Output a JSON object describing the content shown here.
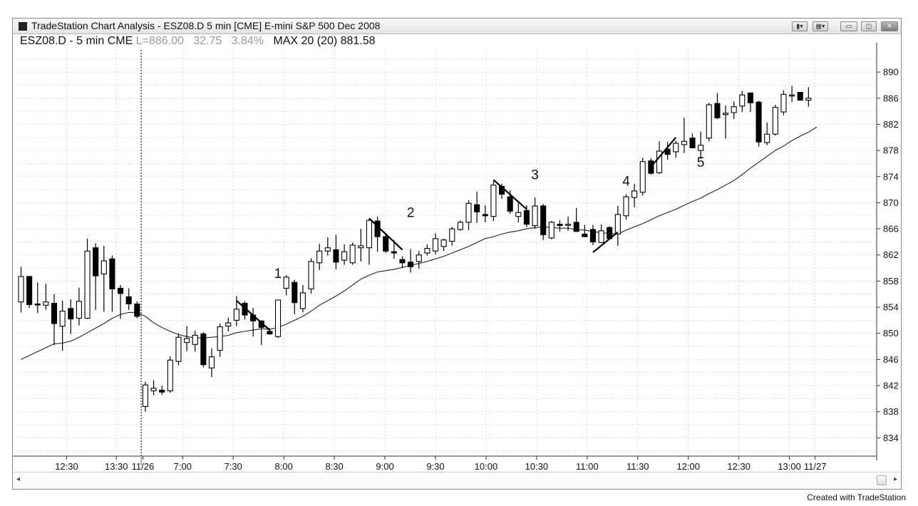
{
  "window": {
    "title": "TradeStation Chart Analysis - ESZ08.D 5 min [CME] E-mini S&P 500 Dec 2008",
    "buttons": [
      "bar-chart-icon",
      "grid-icon",
      "minimize-icon",
      "restore-icon",
      "close-icon"
    ]
  },
  "header": {
    "symbol": "ESZ08.D - 5 min CME",
    "last": "L=886.00",
    "change": "32.75",
    "pct": "3.84%",
    "study": "MAX 20 (20) 881.58"
  },
  "credit": "Created with TradeStation",
  "colors": {
    "candle": "#000000",
    "grid": "#9a9a9a",
    "ma": "#222222"
  },
  "chart_data": {
    "type": "candlestick",
    "y_ticks": [
      890,
      886,
      882,
      878,
      874,
      870,
      866,
      862,
      858,
      854,
      850,
      846,
      842,
      838,
      834
    ],
    "ylim": [
      831.2,
      893.4
    ],
    "x_labels": [
      "12:30",
      "13:30",
      "11/26",
      "7:00",
      "7:30",
      "8:00",
      "8:30",
      "9:00",
      "9:30",
      "10:00",
      "10:30",
      "11:00",
      "11:30",
      "12:00",
      "12:30",
      "13:00",
      "11/27"
    ],
    "session_divider_after_bar": 14,
    "bars": [
      {
        "o": 854.8,
        "h": 860.2,
        "l": 853.2,
        "c": 858.7
      },
      {
        "o": 858.7,
        "h": 858.8,
        "l": 853.9,
        "c": 854.4
      },
      {
        "o": 854.5,
        "h": 857.8,
        "l": 853.1,
        "c": 854.4
      },
      {
        "o": 854.3,
        "h": 857.6,
        "l": 853.6,
        "c": 854.8
      },
      {
        "o": 854.6,
        "h": 856.0,
        "l": 848.2,
        "c": 851.5
      },
      {
        "o": 851.1,
        "h": 855.0,
        "l": 847.3,
        "c": 853.4
      },
      {
        "o": 853.8,
        "h": 855.2,
        "l": 849.9,
        "c": 852.2
      },
      {
        "o": 852.3,
        "h": 857.0,
        "l": 851.2,
        "c": 854.9
      },
      {
        "o": 852.3,
        "h": 864.5,
        "l": 852.2,
        "c": 862.6
      },
      {
        "o": 863.1,
        "h": 863.8,
        "l": 853.6,
        "c": 858.8
      },
      {
        "o": 859.1,
        "h": 863.4,
        "l": 853.3,
        "c": 861.1
      },
      {
        "o": 861.4,
        "h": 861.9,
        "l": 853.3,
        "c": 856.8
      },
      {
        "o": 856.9,
        "h": 857.4,
        "l": 852.2,
        "c": 856.1
      },
      {
        "o": 855.6,
        "h": 856.9,
        "l": 853.6,
        "c": 854.5
      },
      {
        "o": 854.5,
        "h": 854.9,
        "l": 852.3,
        "c": 852.6
      },
      {
        "o": 838.8,
        "h": 842.6,
        "l": 838.0,
        "c": 842.1
      },
      {
        "o": 841.2,
        "h": 842.8,
        "l": 840.5,
        "c": 841.6
      },
      {
        "o": 841.3,
        "h": 842.0,
        "l": 840.6,
        "c": 841.0
      },
      {
        "o": 841.2,
        "h": 846.5,
        "l": 840.9,
        "c": 845.9
      },
      {
        "o": 845.7,
        "h": 850.0,
        "l": 845.1,
        "c": 849.4
      },
      {
        "o": 848.6,
        "h": 851.1,
        "l": 847.3,
        "c": 849.2
      },
      {
        "o": 848.3,
        "h": 850.4,
        "l": 847.2,
        "c": 849.7
      },
      {
        "o": 849.9,
        "h": 850.2,
        "l": 844.8,
        "c": 845.2
      },
      {
        "o": 844.7,
        "h": 847.7,
        "l": 843.3,
        "c": 846.4
      },
      {
        "o": 847.4,
        "h": 851.5,
        "l": 846.4,
        "c": 851.0
      },
      {
        "o": 851.1,
        "h": 852.4,
        "l": 850.3,
        "c": 851.6
      },
      {
        "o": 852.0,
        "h": 855.7,
        "l": 851.1,
        "c": 853.7
      },
      {
        "o": 854.6,
        "h": 854.9,
        "l": 852.1,
        "c": 852.8
      },
      {
        "o": 852.8,
        "h": 853.9,
        "l": 849.5,
        "c": 851.9
      },
      {
        "o": 851.9,
        "h": 851.3,
        "l": 848.2,
        "c": 850.9
      },
      {
        "o": 850.3,
        "h": 850.8,
        "l": 849.8,
        "c": 849.9
      },
      {
        "o": 849.5,
        "h": 852.5,
        "l": 849.3,
        "c": 855.1
      },
      {
        "o": 856.9,
        "h": 858.9,
        "l": 855.8,
        "c": 858.6
      },
      {
        "o": 857.8,
        "h": 858.2,
        "l": 852.9,
        "c": 854.7
      },
      {
        "o": 853.8,
        "h": 857.4,
        "l": 853.2,
        "c": 856.2
      },
      {
        "o": 856.8,
        "h": 861.5,
        "l": 856.1,
        "c": 861.0
      },
      {
        "o": 860.8,
        "h": 863.7,
        "l": 859.7,
        "c": 862.6
      },
      {
        "o": 862.6,
        "h": 864.7,
        "l": 861.9,
        "c": 863.1
      },
      {
        "o": 862.8,
        "h": 865.1,
        "l": 859.8,
        "c": 860.9
      },
      {
        "o": 861.2,
        "h": 863.6,
        "l": 860.5,
        "c": 862.5
      },
      {
        "o": 860.8,
        "h": 863.9,
        "l": 860.5,
        "c": 863.5
      },
      {
        "o": 863.1,
        "h": 866.0,
        "l": 861.0,
        "c": 863.4
      },
      {
        "o": 863.1,
        "h": 867.6,
        "l": 860.5,
        "c": 867.3
      },
      {
        "o": 867.2,
        "h": 867.9,
        "l": 862.5,
        "c": 864.8
      },
      {
        "o": 864.8,
        "h": 865.3,
        "l": 862.3,
        "c": 862.6
      },
      {
        "o": 862.5,
        "h": 864.3,
        "l": 861.4,
        "c": 862.3
      },
      {
        "o": 861.3,
        "h": 861.8,
        "l": 860.0,
        "c": 860.8
      },
      {
        "o": 860.9,
        "h": 862.9,
        "l": 859.3,
        "c": 860.2
      },
      {
        "o": 861.0,
        "h": 862.6,
        "l": 859.9,
        "c": 862.0
      },
      {
        "o": 862.3,
        "h": 863.6,
        "l": 861.9,
        "c": 863.0
      },
      {
        "o": 862.6,
        "h": 865.3,
        "l": 862.1,
        "c": 864.5
      },
      {
        "o": 863.3,
        "h": 864.5,
        "l": 862.6,
        "c": 864.3
      },
      {
        "o": 864.1,
        "h": 866.3,
        "l": 863.4,
        "c": 866.0
      },
      {
        "o": 865.9,
        "h": 867.3,
        "l": 865.7,
        "c": 867.0
      },
      {
        "o": 867.0,
        "h": 870.4,
        "l": 865.8,
        "c": 869.9
      },
      {
        "o": 869.7,
        "h": 871.7,
        "l": 866.9,
        "c": 868.6
      },
      {
        "o": 868.2,
        "h": 869.6,
        "l": 867.0,
        "c": 868.0
      },
      {
        "o": 867.9,
        "h": 873.3,
        "l": 867.2,
        "c": 872.7
      },
      {
        "o": 872.5,
        "h": 872.9,
        "l": 870.6,
        "c": 871.3
      },
      {
        "o": 870.9,
        "h": 871.9,
        "l": 868.3,
        "c": 868.7
      },
      {
        "o": 867.9,
        "h": 870.3,
        "l": 867.0,
        "c": 868.5
      },
      {
        "o": 868.8,
        "h": 869.6,
        "l": 866.3,
        "c": 866.7
      },
      {
        "o": 866.5,
        "h": 870.8,
        "l": 866.0,
        "c": 869.5
      },
      {
        "o": 869.5,
        "h": 869.8,
        "l": 864.3,
        "c": 865.1
      },
      {
        "o": 864.6,
        "h": 867.2,
        "l": 864.4,
        "c": 867.0
      },
      {
        "o": 866.7,
        "h": 867.3,
        "l": 865.6,
        "c": 866.5
      },
      {
        "o": 866.7,
        "h": 867.9,
        "l": 865.7,
        "c": 866.7
      },
      {
        "o": 867.0,
        "h": 869.2,
        "l": 865.7,
        "c": 865.6
      },
      {
        "o": 865.2,
        "h": 866.6,
        "l": 864.9,
        "c": 864.8
      },
      {
        "o": 865.9,
        "h": 866.6,
        "l": 863.5,
        "c": 864.0
      },
      {
        "o": 863.9,
        "h": 866.7,
        "l": 864.1,
        "c": 865.7
      },
      {
        "o": 866.2,
        "h": 866.4,
        "l": 864.7,
        "c": 864.5
      },
      {
        "o": 865.2,
        "h": 869.5,
        "l": 863.4,
        "c": 868.2
      },
      {
        "o": 868.0,
        "h": 871.3,
        "l": 867.4,
        "c": 870.9
      },
      {
        "o": 870.8,
        "h": 872.9,
        "l": 869.3,
        "c": 871.8
      },
      {
        "o": 871.6,
        "h": 876.9,
        "l": 871.1,
        "c": 876.3
      },
      {
        "o": 876.4,
        "h": 876.8,
        "l": 874.3,
        "c": 874.5
      },
      {
        "o": 874.6,
        "h": 879.4,
        "l": 874.4,
        "c": 877.9
      },
      {
        "o": 878.2,
        "h": 879.3,
        "l": 876.6,
        "c": 877.4
      },
      {
        "o": 877.8,
        "h": 879.5,
        "l": 876.9,
        "c": 879.1
      },
      {
        "o": 878.9,
        "h": 883.0,
        "l": 877.6,
        "c": 879.4
      },
      {
        "o": 879.9,
        "h": 880.6,
        "l": 878.4,
        "c": 878.4
      },
      {
        "o": 878.0,
        "h": 880.9,
        "l": 876.7,
        "c": 878.8
      },
      {
        "o": 879.9,
        "h": 885.3,
        "l": 879.4,
        "c": 885.0
      },
      {
        "o": 885.2,
        "h": 886.8,
        "l": 882.8,
        "c": 883.0
      },
      {
        "o": 883.5,
        "h": 884.9,
        "l": 879.8,
        "c": 883.7
      },
      {
        "o": 883.8,
        "h": 885.5,
        "l": 882.8,
        "c": 884.7
      },
      {
        "o": 884.8,
        "h": 887.1,
        "l": 883.9,
        "c": 886.5
      },
      {
        "o": 886.8,
        "h": 886.9,
        "l": 883.9,
        "c": 885.3
      },
      {
        "o": 885.4,
        "h": 885.6,
        "l": 878.6,
        "c": 879.3
      },
      {
        "o": 879.2,
        "h": 882.3,
        "l": 878.8,
        "c": 880.5
      },
      {
        "o": 880.5,
        "h": 885.0,
        "l": 880.3,
        "c": 884.6
      },
      {
        "o": 883.9,
        "h": 887.2,
        "l": 883.4,
        "c": 886.6
      },
      {
        "o": 886.4,
        "h": 887.9,
        "l": 885.4,
        "c": 886.5
      },
      {
        "o": 886.9,
        "h": 886.7,
        "l": 885.7,
        "c": 885.7
      },
      {
        "o": 885.7,
        "h": 887.7,
        "l": 884.7,
        "c": 886.0
      }
    ],
    "moving_average": {
      "name": "MAX 20",
      "values": [
        846.0,
        846.6,
        847.2,
        847.8,
        848.4,
        848.5,
        848.8,
        849.4,
        850.1,
        850.8,
        851.5,
        852.3,
        852.9,
        853.2,
        853.2,
        852.6,
        851.6,
        850.9,
        850.3,
        849.8,
        849.5,
        849.3,
        849.3,
        849.4,
        849.5,
        849.7,
        850.1,
        850.3,
        850.5,
        850.7,
        850.6,
        850.9,
        851.4,
        852.0,
        852.6,
        853.4,
        854.3,
        855.0,
        855.7,
        856.5,
        857.4,
        858.3,
        858.9,
        859.4,
        859.6,
        859.8,
        860.1,
        860.4,
        860.7,
        861.0,
        861.4,
        861.8,
        862.3,
        862.8,
        863.3,
        863.9,
        864.5,
        864.8,
        865.2,
        865.5,
        865.7,
        866.0,
        866.2,
        866.3,
        866.2,
        866.1,
        866.1,
        865.9,
        865.8,
        865.6,
        865.4,
        865.3,
        865.2,
        865.8,
        866.3,
        866.8,
        867.4,
        868.0,
        868.5,
        869.0,
        869.6,
        870.2,
        870.7,
        871.4,
        872.0,
        872.7,
        873.4,
        874.3,
        875.3,
        876.2,
        877.1,
        878.0,
        878.7,
        879.5,
        880.2,
        880.8,
        881.6
      ]
    },
    "annotations": [
      {
        "text": "1",
        "bar": 31,
        "y": 858.5
      },
      {
        "text": "2",
        "bar": 47,
        "y": 867.8
      },
      {
        "text": "3",
        "bar": 62,
        "y": 873.6
      },
      {
        "text": "4",
        "bar": 73,
        "y": 872.6
      },
      {
        "text": "5",
        "bar": 82,
        "y": 875.5
      }
    ],
    "trendlines": [
      {
        "from": {
          "bar": 26,
          "y": 855.0
        },
        "to": {
          "bar": 30,
          "y": 850.5
        }
      },
      {
        "from": {
          "bar": 42,
          "y": 867.6
        },
        "to": {
          "bar": 46,
          "y": 862.8
        }
      },
      {
        "from": {
          "bar": 57,
          "y": 873.5
        },
        "to": {
          "bar": 61,
          "y": 869.0
        }
      },
      {
        "from": {
          "bar": 69,
          "y": 862.4
        },
        "to": {
          "bar": 72,
          "y": 865.5
        }
      },
      {
        "from": {
          "bar": 76,
          "y": 875.5
        },
        "to": {
          "bar": 79,
          "y": 880.0
        }
      }
    ]
  }
}
